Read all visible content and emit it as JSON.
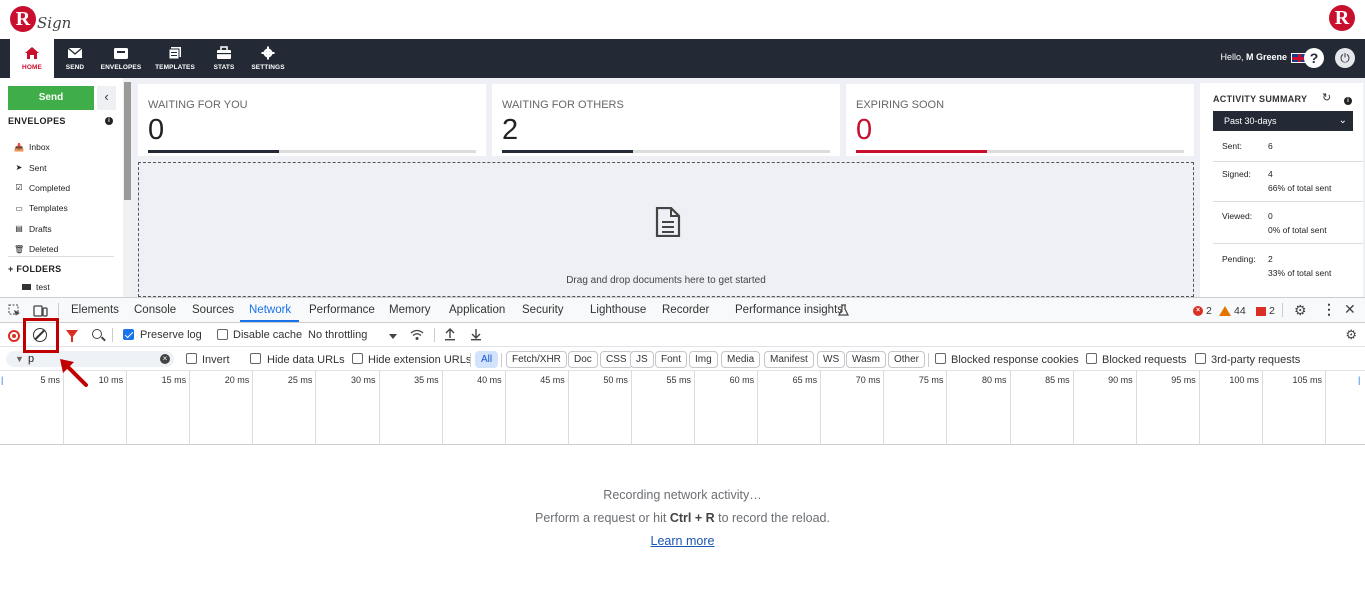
{
  "header": {
    "logo_letter": "R",
    "logo_text": "Sign",
    "right_logo_letter": "R",
    "greeting_prefix": "Hello,",
    "greeting_name": "M Greene",
    "help_symbol": "?",
    "power_symbol": "⏻"
  },
  "nav": {
    "items": [
      {
        "label": "HOME",
        "icon": "home-icon"
      },
      {
        "label": "SEND",
        "icon": "envelope-icon"
      },
      {
        "label": "ENVELOPES",
        "icon": "inbox-icon"
      },
      {
        "label": "TEMPLATES",
        "icon": "templates-icon"
      },
      {
        "label": "STATS",
        "icon": "briefcase-icon"
      },
      {
        "label": "SETTINGS",
        "icon": "gear-icon"
      }
    ]
  },
  "sidebar": {
    "send_label": "Send",
    "collapse_symbol": "‹",
    "envelopes_title": "ENVELOPES",
    "info_symbol": "i",
    "items": [
      {
        "label": "Inbox",
        "icon": "📥"
      },
      {
        "label": "Sent",
        "icon": "➤"
      },
      {
        "label": "Completed",
        "icon": "☑"
      },
      {
        "label": "Templates",
        "icon": "▭"
      },
      {
        "label": "Drafts",
        "icon": "▤"
      },
      {
        "label": "Deleted",
        "icon": "🗑"
      }
    ],
    "folders_title": "+ FOLDERS",
    "folder_name": "test"
  },
  "stats": [
    {
      "title": "WAITING FOR YOU",
      "value": "0",
      "fill_fraction": 0.4,
      "color": "#232a35"
    },
    {
      "title": "WAITING FOR OTHERS",
      "value": "2",
      "fill_fraction": 0.4,
      "color": "#232a35"
    },
    {
      "title": "EXPIRING SOON",
      "value": "0",
      "fill_fraction": 0.4,
      "color": "#c8102e"
    }
  ],
  "dropzone": {
    "text": "Drag and drop documents here to get started"
  },
  "activity": {
    "title": "ACTIVITY SUMMARY",
    "refresh_symbol": "↻",
    "info_symbol": "i",
    "period": "Past 30-days",
    "chevron": "⌄",
    "rows": [
      {
        "key": "Sent:",
        "value": "6",
        "sub": ""
      },
      {
        "key": "Signed:",
        "value": "4",
        "sub": "66% of total sent"
      },
      {
        "key": "Viewed:",
        "value": "0",
        "sub": "0% of total sent"
      },
      {
        "key": "Pending:",
        "value": "2",
        "sub": "33% of total sent"
      }
    ]
  },
  "devtools": {
    "tabs": [
      "Elements",
      "Console",
      "Sources",
      "Network",
      "Performance",
      "Memory",
      "Application",
      "Security",
      "Lighthouse",
      "Recorder",
      "Performance insights"
    ],
    "active_tab": "Network",
    "error_count": "2",
    "warning_count": "44",
    "issue_count": "2",
    "toolbar": {
      "preserve_log": "Preserve log",
      "preserve_log_checked": true,
      "disable_cache": "Disable cache",
      "disable_cache_checked": false,
      "throttling": "No throttling"
    },
    "filter": {
      "value": "p",
      "invert": "Invert",
      "hide_data_urls": "Hide data URLs",
      "hide_extension_urls": "Hide extension URLs",
      "types": [
        "All",
        "Fetch/XHR",
        "Doc",
        "CSS",
        "JS",
        "Font",
        "Img",
        "Media",
        "Manifest",
        "WS",
        "Wasm",
        "Other"
      ],
      "active_type": "All",
      "blocked_cookies": "Blocked response cookies",
      "blocked_requests": "Blocked requests",
      "third_party": "3rd-party requests"
    },
    "timeline_ticks": [
      "5 ms",
      "10 ms",
      "15 ms",
      "20 ms",
      "25 ms",
      "30 ms",
      "35 ms",
      "40 ms",
      "45 ms",
      "50 ms",
      "55 ms",
      "60 ms",
      "65 ms",
      "70 ms",
      "75 ms",
      "80 ms",
      "85 ms",
      "90 ms",
      "95 ms",
      "100 ms",
      "105 ms"
    ],
    "empty_state": {
      "line1": "Recording network activity…",
      "line2_prefix": "Perform a request or hit",
      "shortcut": "Ctrl + R",
      "line2_suffix": "to record the reload.",
      "link": "Learn more"
    }
  },
  "colors": {
    "brand_red": "#c8102e",
    "navbar": "#232a35",
    "send_green": "#3fae49",
    "devtools_blue": "#1a73e8",
    "annotation_red": "#c00000"
  }
}
